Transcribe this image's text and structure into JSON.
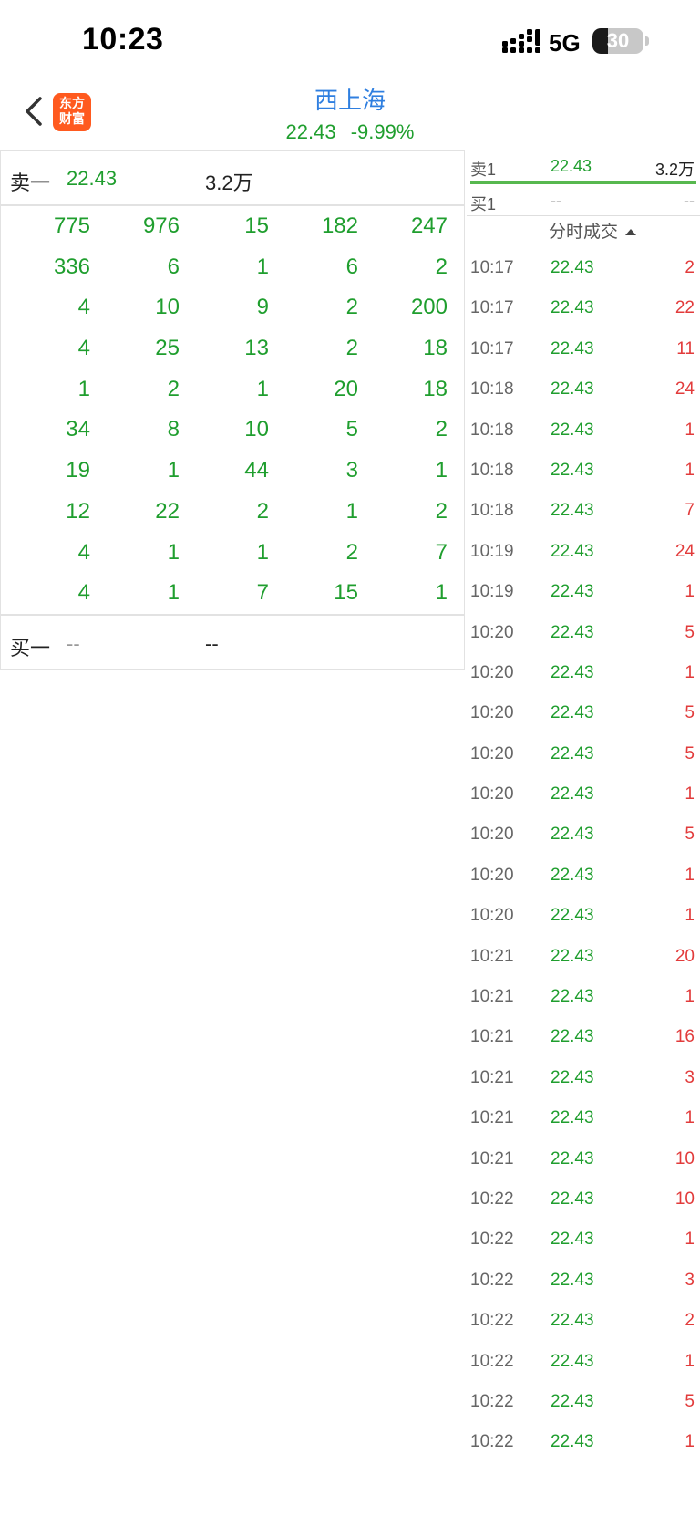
{
  "status_bar": {
    "time": "10:23",
    "network": "5G",
    "battery": "30",
    "battery_level_percent": 30
  },
  "header": {
    "logo_text": "东方\n财富",
    "stock_name": "西上海",
    "price": "22.43",
    "change_pct": "-9.99%"
  },
  "order_book": {
    "ask": {
      "label": "卖一",
      "price": "22.43",
      "volume": "3.2万"
    },
    "queue": [
      [
        "775",
        "976",
        "15",
        "182",
        "247"
      ],
      [
        "336",
        "6",
        "1",
        "6",
        "2"
      ],
      [
        "4",
        "10",
        "9",
        "2",
        "200"
      ],
      [
        "4",
        "25",
        "13",
        "2",
        "18"
      ],
      [
        "1",
        "2",
        "1",
        "20",
        "18"
      ],
      [
        "34",
        "8",
        "10",
        "5",
        "2"
      ],
      [
        "19",
        "1",
        "44",
        "3",
        "1"
      ],
      [
        "12",
        "22",
        "2",
        "1",
        "2"
      ],
      [
        "4",
        "1",
        "1",
        "2",
        "7"
      ],
      [
        "4",
        "1",
        "7",
        "15",
        "1"
      ]
    ],
    "bid": {
      "label": "买一",
      "price": "--",
      "volume": "--"
    }
  },
  "levels": {
    "sell1": {
      "label": "卖1",
      "price": "22.43",
      "volume": "3.2万"
    },
    "buy1": {
      "label": "买1",
      "price": "--",
      "volume": "--"
    }
  },
  "ticks": {
    "header": "分时成交",
    "rows": [
      {
        "time": "10:17",
        "price": "22.43",
        "volume": "2"
      },
      {
        "time": "10:17",
        "price": "22.43",
        "volume": "22"
      },
      {
        "time": "10:17",
        "price": "22.43",
        "volume": "11"
      },
      {
        "time": "10:18",
        "price": "22.43",
        "volume": "24"
      },
      {
        "time": "10:18",
        "price": "22.43",
        "volume": "1"
      },
      {
        "time": "10:18",
        "price": "22.43",
        "volume": "1"
      },
      {
        "time": "10:18",
        "price": "22.43",
        "volume": "7"
      },
      {
        "time": "10:19",
        "price": "22.43",
        "volume": "24"
      },
      {
        "time": "10:19",
        "price": "22.43",
        "volume": "1"
      },
      {
        "time": "10:20",
        "price": "22.43",
        "volume": "5"
      },
      {
        "time": "10:20",
        "price": "22.43",
        "volume": "1"
      },
      {
        "time": "10:20",
        "price": "22.43",
        "volume": "5"
      },
      {
        "time": "10:20",
        "price": "22.43",
        "volume": "5"
      },
      {
        "time": "10:20",
        "price": "22.43",
        "volume": "1"
      },
      {
        "time": "10:20",
        "price": "22.43",
        "volume": "5"
      },
      {
        "time": "10:20",
        "price": "22.43",
        "volume": "1"
      },
      {
        "time": "10:20",
        "price": "22.43",
        "volume": "1"
      },
      {
        "time": "10:21",
        "price": "22.43",
        "volume": "20"
      },
      {
        "time": "10:21",
        "price": "22.43",
        "volume": "1"
      },
      {
        "time": "10:21",
        "price": "22.43",
        "volume": "16"
      },
      {
        "time": "10:21",
        "price": "22.43",
        "volume": "3"
      },
      {
        "time": "10:21",
        "price": "22.43",
        "volume": "1"
      },
      {
        "time": "10:21",
        "price": "22.43",
        "volume": "10"
      },
      {
        "time": "10:22",
        "price": "22.43",
        "volume": "10"
      },
      {
        "time": "10:22",
        "price": "22.43",
        "volume": "1"
      },
      {
        "time": "10:22",
        "price": "22.43",
        "volume": "3"
      },
      {
        "time": "10:22",
        "price": "22.43",
        "volume": "2"
      },
      {
        "time": "10:22",
        "price": "22.43",
        "volume": "1"
      },
      {
        "time": "10:22",
        "price": "22.43",
        "volume": "5"
      },
      {
        "time": "10:22",
        "price": "22.43",
        "volume": "1"
      }
    ]
  },
  "colors": {
    "price_down": "#1f9e2e",
    "trade_volume": "#e23b3b",
    "stock_name": "#2f7fe0",
    "logo": "#ff5a1f",
    "level_divider": "#57b84f"
  },
  "icons": {
    "back": "chevron-left-icon",
    "sort": "triangle-up-icon",
    "signal": "cellular-signal-icon",
    "battery": "battery-icon"
  }
}
